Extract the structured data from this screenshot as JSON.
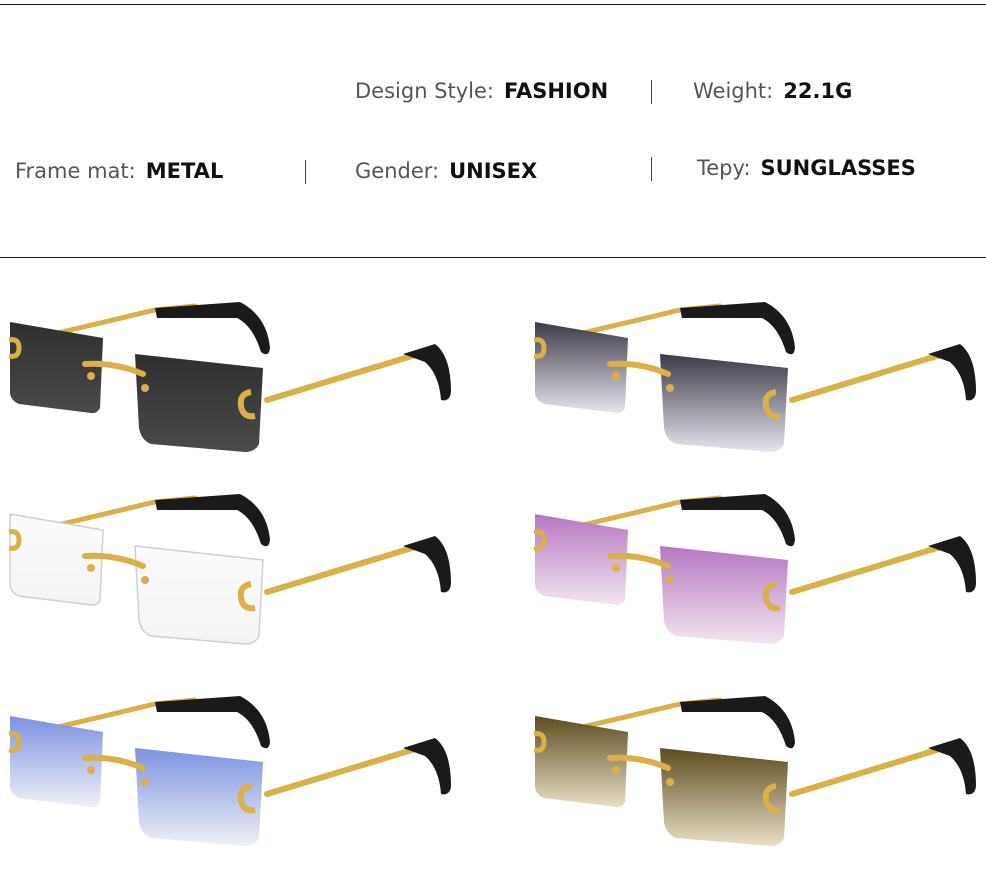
{
  "specs": {
    "design_style": {
      "label": "Design Style:",
      "value": "FASHION"
    },
    "weight": {
      "label": "Weight:",
      "value": "22.1G"
    },
    "frame_mat": {
      "label": "Frame mat:",
      "value": "METAL"
    },
    "gender": {
      "label": "Gender:",
      "value": "UNISEX"
    },
    "type": {
      "label": "Tepy:",
      "value": "SUNGLASSES"
    }
  },
  "colors": {
    "frame_gold": "#d9b04a",
    "temple_tip": "#1a1a1a"
  },
  "variants": [
    {
      "name": "black",
      "lens_top": "#2f2f2f",
      "lens_bottom": "#4a4a4a"
    },
    {
      "name": "grey-gradient",
      "lens_top": "#3d3a48",
      "lens_bottom": "#e6e4ec"
    },
    {
      "name": "clear",
      "lens_top": "#fbfbfb",
      "lens_bottom": "#f4f4f4"
    },
    {
      "name": "pink-gradient",
      "lens_top": "#b676c2",
      "lens_bottom": "#f2e6ef"
    },
    {
      "name": "blue-gradient",
      "lens_top": "#7d92e0",
      "lens_bottom": "#eef1f6"
    },
    {
      "name": "brown-gradient",
      "lens_top": "#5e4b20",
      "lens_bottom": "#e9dfc7"
    }
  ]
}
